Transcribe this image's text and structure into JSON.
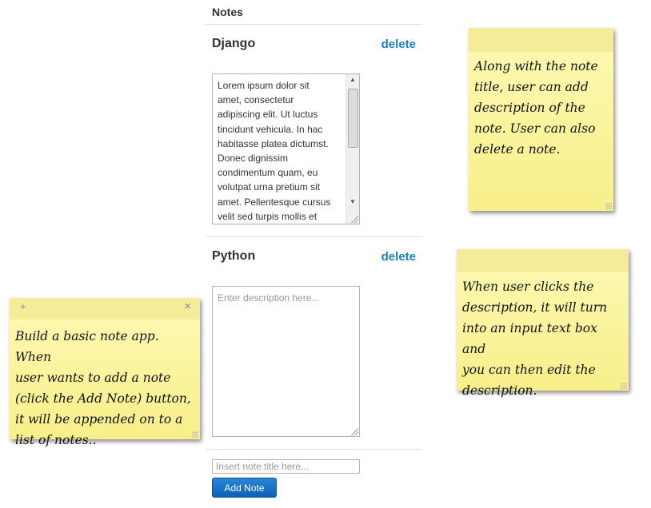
{
  "panel": {
    "title": "Notes",
    "notes": [
      {
        "title": "Django",
        "delete_label": "delete",
        "description": "Lorem ipsum dolor sit\namet, consectetur\nadipiscing elit. Ut luctus\ntincidunt vehicula. In hac\nhabitasse platea dictumst.\nDonec dignissim\ncondimentum quam, eu\nvolutpat urna pretium sit\namet. Pellentesque cursus\nvelit sed turpis mollis et"
      },
      {
        "title": "Python",
        "delete_label": "delete",
        "description_placeholder": "Enter description here..."
      }
    ],
    "title_input_placeholder": "Insert note title here...",
    "add_button_label": "Add Note"
  },
  "stickies": {
    "left": {
      "add_glyph": "+",
      "close_glyph": "×",
      "text": "Build a basic note app. When\nuser wants to add a note\n(click the Add Note) button,\nit will be appended on to a\nlist of notes.."
    },
    "top_right": {
      "text": "Along with the note\ntitle, user can add\ndescription of the\nnote. User can also\ndelete a note."
    },
    "middle_right": {
      "text": "When user clicks the\ndescription, it will turn\ninto an input text box and\nyou can then edit the\ndescription."
    }
  },
  "icons": {
    "scroll_up": "scroll-up-arrow-icon",
    "scroll_down": "scroll-down-arrow-icon",
    "resize_grip": "resize-grip-icon",
    "plus": "plus-icon",
    "close": "close-icon"
  },
  "colors": {
    "link": "#1a7fc1",
    "sticky_yellow": "#f8ef8a",
    "button_blue": "#0d5fb7"
  }
}
